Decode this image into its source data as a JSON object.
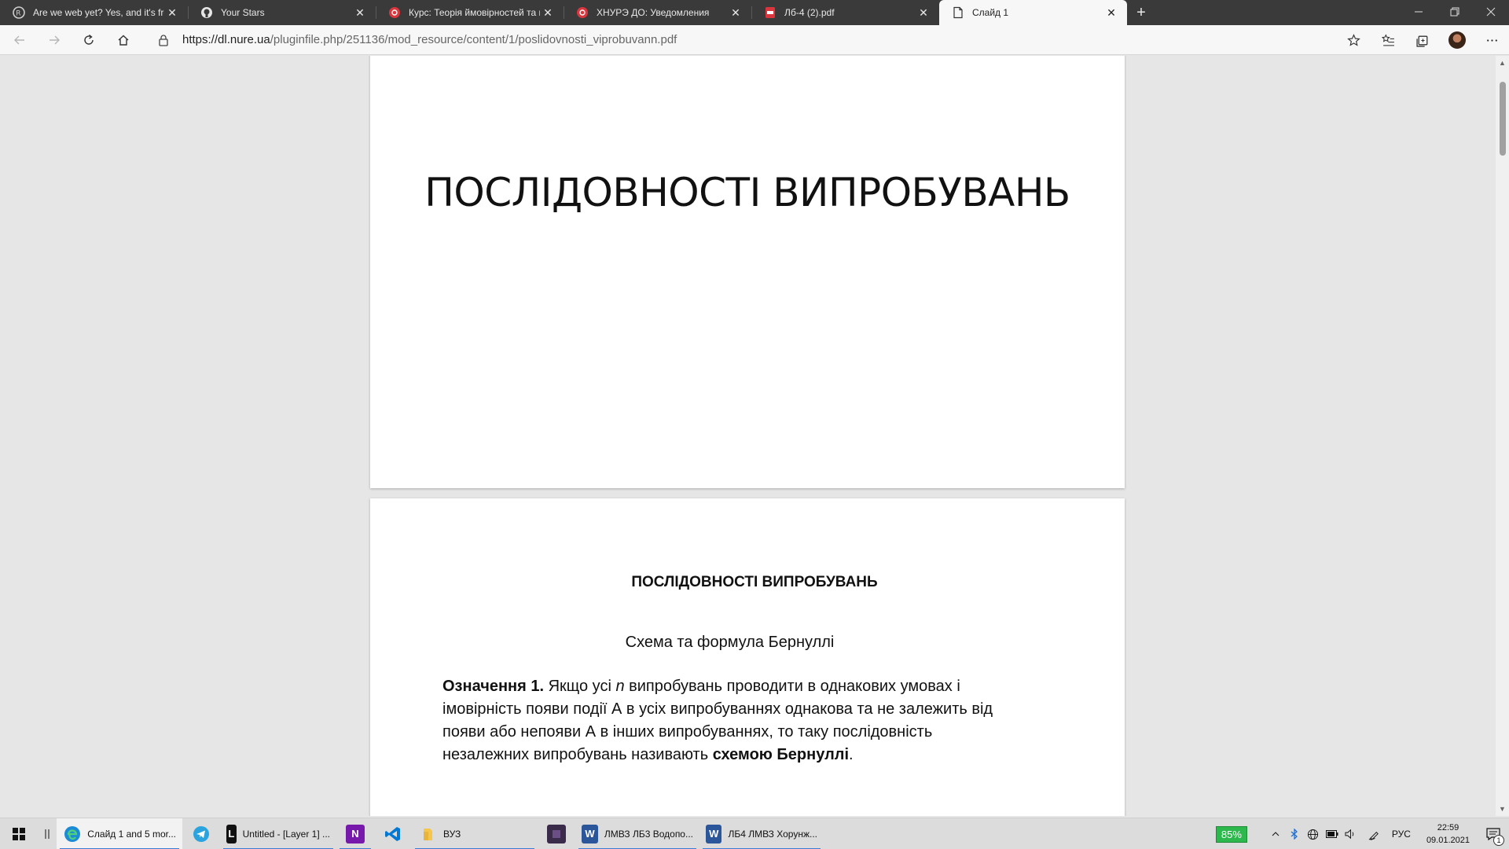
{
  "tabs": [
    {
      "title": "Are we web yet? Yes, and it's freaking fast!",
      "icon": "rust-logo-icon"
    },
    {
      "title": "Your Stars",
      "icon": "github-icon"
    },
    {
      "title": "Курс: Теорія ймовірностей та математичної статистики",
      "icon": "nure-logo-icon"
    },
    {
      "title": "ХНУРЭ ДО: Уведомления",
      "icon": "nure-logo-icon"
    },
    {
      "title": "Лб-4 (2).pdf",
      "icon": "pdf-icon"
    },
    {
      "title": "Слайд 1",
      "icon": "document-icon"
    }
  ],
  "tab_close_glyph": "✕",
  "new_tab_glyph": "+",
  "address": {
    "url_host": "https://dl.nure.ua",
    "url_path": "/pluginfile.php/251136/mod_resource/content/1/poslidovnosti_viprobuvann.pdf"
  },
  "pdf": {
    "page1_title": "ПОСЛІДОВНОСТІ ВИПРОБУВАНЬ",
    "page2_heading": "ПОСЛІДОВНОСТІ ВИПРОБУВАНЬ",
    "page2_subheading": "Схема та формула Бернуллі",
    "definition_label": "Означення 1.",
    "definition_text_1": " Якщо усі ",
    "definition_var": "n",
    "definition_text_2": " випробувань проводити в однакових умовах і імовірність появи події А в усіх випробуваннях однакова та не залежить від появи або непояви А в інших випробуваннях, то таку послідовність незалежних випробувань називають ",
    "definition_term": "схемою Бернуллі",
    "definition_end": "."
  },
  "taskbar": {
    "items": [
      {
        "label": "Слайд 1 and 5 mor...",
        "icon": "edge-icon"
      },
      {
        "label": "",
        "icon": "telegram-icon"
      },
      {
        "label": "Untitled - [Layer 1] ...",
        "icon": "app-l-icon"
      },
      {
        "label": "",
        "icon": "onenote-icon"
      },
      {
        "label": "",
        "icon": "vscode-icon"
      },
      {
        "label": "ВУЗ",
        "icon": "folder-icon"
      },
      {
        "label": "",
        "icon": "app-dark-icon"
      },
      {
        "label": "ЛМВЗ ЛБ3 Водопо...",
        "icon": "word-icon"
      },
      {
        "label": "ЛБ4 ЛМВЗ Хорунж...",
        "icon": "word-icon"
      }
    ],
    "battery": "85%",
    "language": "РУС",
    "time": "22:59",
    "date": "09.01.2021",
    "notifications": "1",
    "colors": {
      "battery_bg": "#2db84d",
      "word": "#2b579a",
      "onenote": "#7719aa",
      "vscode": "#0078d4",
      "telegram": "#2aa3df"
    }
  }
}
